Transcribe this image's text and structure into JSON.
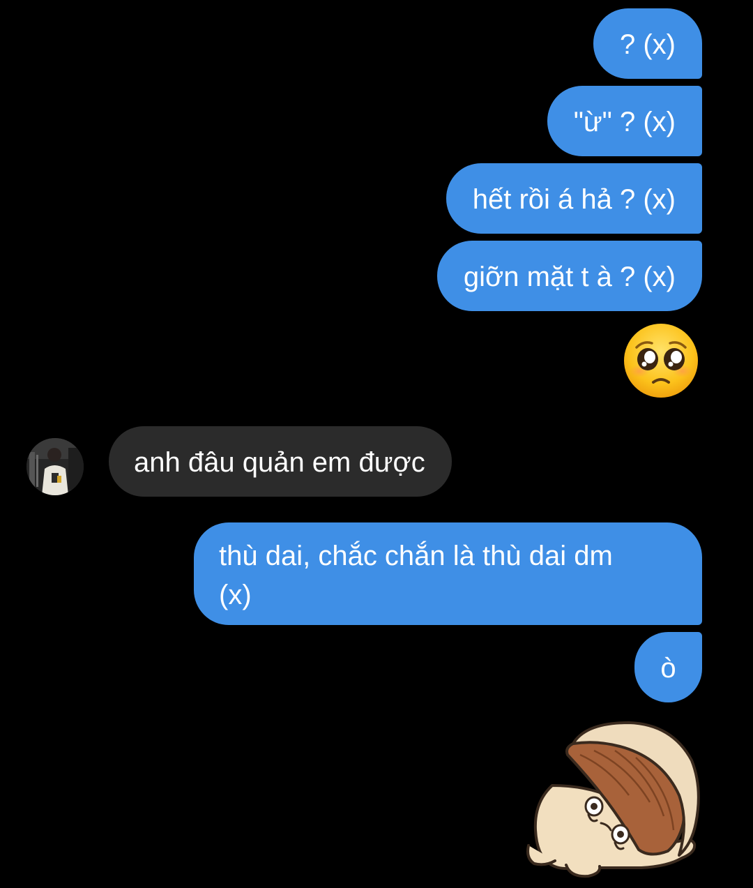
{
  "conversation": {
    "messages": [
      {
        "id": "m1",
        "direction": "outgoing",
        "text": "? (x)"
      },
      {
        "id": "m2",
        "direction": "outgoing",
        "text": "\"ừ\" ? (x)"
      },
      {
        "id": "m3",
        "direction": "outgoing",
        "text": "hết rồi á hả ? (x)"
      },
      {
        "id": "m4",
        "direction": "outgoing",
        "text": "giỡn mặt t à ? (x)"
      },
      {
        "id": "m5",
        "direction": "outgoing",
        "kind": "emoji",
        "emoji": "pleading-face",
        "text": "🥺"
      },
      {
        "id": "m6",
        "direction": "incoming",
        "text": "anh đâu quản em được"
      },
      {
        "id": "m7",
        "direction": "outgoing",
        "text_line1": "thù dai, chắc chắn là thù dai dm",
        "text_line2": "(x)"
      },
      {
        "id": "m8",
        "direction": "outgoing",
        "text": "ò"
      },
      {
        "id": "m9",
        "direction": "outgoing",
        "kind": "sticker",
        "sticker": "crying-mushroom-sticker"
      }
    ]
  },
  "contact": {
    "avatar_icon": "profile-photo-avatar"
  },
  "colors": {
    "background": "#000000",
    "outgoing_bubble": "#3f8fe6",
    "incoming_bubble": "#2b2b2b",
    "text": "#ffffff"
  }
}
